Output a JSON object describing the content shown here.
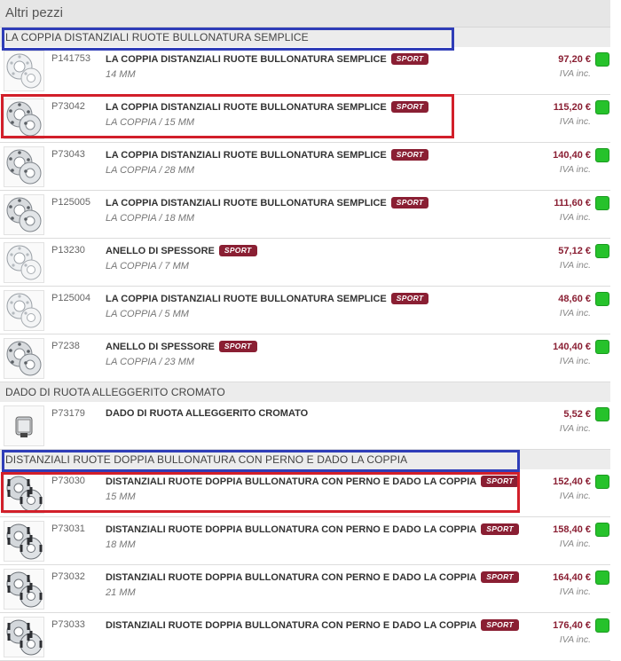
{
  "panel": {
    "title": "Altri pezzi"
  },
  "sections": [
    {
      "title": "LA COPPIA DISTANZIALI RUOTE BULLONATURA SEMPLICE",
      "rows": [
        {
          "code": "P141753",
          "title": "LA COPPIA DISTANZIALI RUOTE BULLONATURA SEMPLICE",
          "badge": "SPORT",
          "subtitle": "14 MM",
          "price": "97,20 €",
          "vat": "IVA inc.",
          "thumb_icon": "wheel-spacer-thin-icon"
        },
        {
          "code": "P73042",
          "title": "LA COPPIA DISTANZIALI RUOTE BULLONATURA SEMPLICE",
          "badge": "SPORT",
          "subtitle": "LA COPPIA / 15 MM",
          "price": "115,20 €",
          "vat": "IVA inc.",
          "thumb_icon": "wheel-spacer-icon"
        },
        {
          "code": "P73043",
          "title": "LA COPPIA DISTANZIALI RUOTE BULLONATURA SEMPLICE",
          "badge": "SPORT",
          "subtitle": "LA COPPIA / 28 MM",
          "price": "140,40 €",
          "vat": "IVA inc.",
          "thumb_icon": "wheel-spacer-icon"
        },
        {
          "code": "P125005",
          "title": "LA COPPIA DISTANZIALI RUOTE BULLONATURA SEMPLICE",
          "badge": "SPORT",
          "subtitle": "LA COPPIA / 18 MM",
          "price": "111,60 €",
          "vat": "IVA inc.",
          "thumb_icon": "wheel-spacer-icon"
        },
        {
          "code": "P13230",
          "title": "ANELLO DI SPESSORE",
          "badge": "SPORT",
          "subtitle": "LA COPPIA / 7 MM",
          "price": "57,12 €",
          "vat": "IVA inc.",
          "thumb_icon": "spacer-ring-icon"
        },
        {
          "code": "P125004",
          "title": "LA COPPIA DISTANZIALI RUOTE BULLONATURA SEMPLICE",
          "badge": "SPORT",
          "subtitle": "LA COPPIA / 5 MM",
          "price": "48,60 €",
          "vat": "IVA inc.",
          "thumb_icon": "spacer-ring-icon"
        },
        {
          "code": "P7238",
          "title": "ANELLO DI SPESSORE",
          "badge": "SPORT",
          "subtitle": "LA COPPIA / 23 MM",
          "price": "140,40 €",
          "vat": "IVA inc.",
          "thumb_icon": "wheel-spacer-icon"
        }
      ]
    },
    {
      "title": "DADO DI RUOTA ALLEGGERITO CROMATO",
      "rows": [
        {
          "code": "P73179",
          "title": "DADO DI RUOTA ALLEGGERITO CROMATO",
          "badge": "",
          "subtitle": "",
          "price": "5,52 €",
          "vat": "IVA inc.",
          "thumb_icon": "wheel-nut-icon"
        }
      ]
    },
    {
      "title": "DISTANZIALI RUOTE DOPPIA BULLONATURA CON PERNO E DADO LA COPPIA",
      "rows": [
        {
          "code": "P73030",
          "title": "DISTANZIALI RUOTE DOPPIA BULLONATURA CON PERNO E DADO LA COPPIA",
          "badge": "SPORT",
          "subtitle": "15 MM",
          "price": "152,40 €",
          "vat": "IVA inc.",
          "thumb_icon": "bolted-spacer-icon"
        },
        {
          "code": "P73031",
          "title": "DISTANZIALI RUOTE DOPPIA BULLONATURA CON PERNO E DADO LA COPPIA",
          "badge": "SPORT",
          "subtitle": "18 MM",
          "price": "158,40 €",
          "vat": "IVA inc.",
          "thumb_icon": "bolted-spacer-icon"
        },
        {
          "code": "P73032",
          "title": "DISTANZIALI RUOTE DOPPIA BULLONATURA CON PERNO E DADO LA COPPIA",
          "badge": "SPORT",
          "subtitle": "21 MM",
          "price": "164,40 €",
          "vat": "IVA inc.",
          "thumb_icon": "bolted-spacer-icon"
        },
        {
          "code": "P73033",
          "title": "DISTANZIALI RUOTE DOPPIA BULLONATURA CON PERNO E DADO LA COPPIA",
          "badge": "SPORT",
          "subtitle": "",
          "price": "176,40 €",
          "vat": "IVA inc.",
          "thumb_icon": "bolted-spacer-icon"
        }
      ]
    }
  ],
  "colors": {
    "price": "#8a1f33",
    "badge_bg": "#8a1f33",
    "stock_ok": "#26c22b",
    "highlight_blue": "#2f3db8",
    "highlight_red": "#d21f2a"
  }
}
